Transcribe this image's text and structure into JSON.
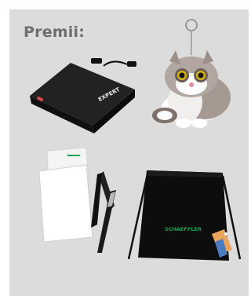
{
  "header": {
    "title": "Premii:"
  },
  "prizes": {
    "powerbank": {
      "name": "powerbank-image",
      "brand": "EXPERT"
    },
    "plush": {
      "name": "raccoon-keychain-image"
    },
    "notepad_set": {
      "name": "notepad-pen-set-image",
      "brand": "SCHAEFFLER"
    },
    "drawstring_bag": {
      "name": "drawstring-bag-image",
      "brand": "SCHAEFFLER"
    }
  },
  "colors": {
    "panel": "#dcdcdc",
    "title": "#6e6e6e",
    "brand_green": "#00a651",
    "tag_orange": "#e9a35a"
  }
}
